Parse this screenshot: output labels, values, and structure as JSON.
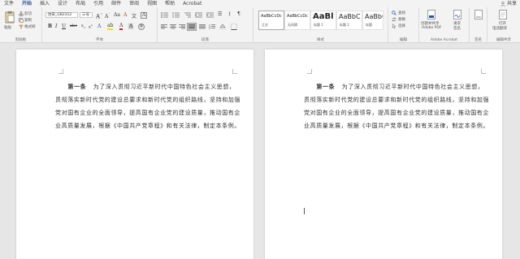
{
  "menu": {
    "tabs": [
      "文件",
      "开始",
      "插入",
      "设计",
      "布局",
      "引用",
      "邮件",
      "审阅",
      "视图",
      "帮助",
      "Acrobat"
    ],
    "active_tab": "开始",
    "share_label": "共享"
  },
  "ribbon": {
    "clipboard": {
      "paste": "粘贴",
      "cut": "剪切",
      "copy": "复制",
      "format_painter": "格式刷",
      "label": "剪贴板"
    },
    "font": {
      "font_name": "仿宋_GB2312",
      "font_size": "三号",
      "label": "字体"
    },
    "paragraph": {
      "label": "段落"
    },
    "styles": {
      "items": [
        {
          "sample": "AaBbCcDc",
          "name": "正文"
        },
        {
          "sample": "AaBbCcDc",
          "name": "无间隔"
        },
        {
          "sample": "AaBl",
          "name": "标题 1"
        },
        {
          "sample": "AaBbC",
          "name": "标题 2"
        },
        {
          "sample": "AaBbC",
          "name": "标题"
        }
      ],
      "label": "样式"
    },
    "editing": {
      "find": "查找",
      "replace": "替换",
      "select": "选择",
      "label": "编辑"
    },
    "acrobat": {
      "create_share": "创建并共享",
      "create_share_2": "Adobe PDF",
      "request_sign": "请求",
      "request_sign_2": "签名",
      "label": "Adobe Acrobat"
    },
    "sign": {
      "label": "签名"
    },
    "edit_share": {
      "open": "打开",
      "open_2": "电话翻译",
      "label": "编辑共享"
    }
  },
  "document": {
    "page1": {
      "heading": "第一条",
      "body": "为了深入贯彻习近平新时代中国特色社会主义思想，贯彻落实新时代党的建设总要求和新时代党的组织路线，坚持和加强党对国有企业的全面领导，提高国有企业党的建设质量，推动国有企业高质量发展，根据《中国共产党章程》和有关法律，制定本条例。"
    },
    "page2": {
      "heading": "第一条",
      "body": "为了深入贯彻习近平新时代中国特色社会主义思想，贯彻落实新时代党的建设总要求和新时代党的组织路线，坚持和加强党对国有企业的全面领导，提高国有企业党的建设质量，推动国有企业高质量发展，根据《中国共产党章程》和有关法律，制定本条例。"
    }
  },
  "colors": {
    "accent": "#2b579a",
    "busy_cursor": "#1e73d8"
  }
}
